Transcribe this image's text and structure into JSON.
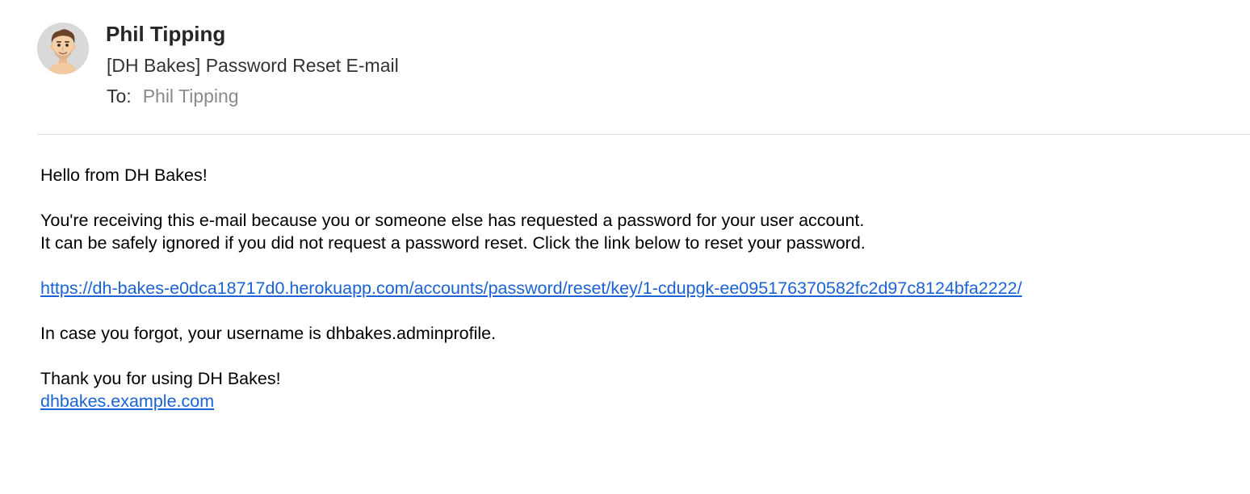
{
  "header": {
    "avatar_icon": "memoji-avatar-icon",
    "sender_name": "Phil Tipping",
    "subject": "[DH Bakes] Password Reset E-mail",
    "to_label": "To:",
    "to_value": "Phil Tipping"
  },
  "body": {
    "greeting": "Hello from DH Bakes!",
    "line1": "You're receiving this e-mail because you or someone else has requested a password for your user account.",
    "line2": "It can be safely ignored if you did not request a password reset. Click the link below to reset your password.",
    "reset_link": "https://dh-bakes-e0dca18717d0.herokuapp.com/accounts/password/reset/key/1-cdupgk-ee095176370582fc2d97c8124bfa2222/",
    "username_note": "In case you forgot, your username is dhbakes.adminprofile.",
    "thanks": "Thank you for using DH Bakes!",
    "site_link": "dhbakes.example.com"
  },
  "colors": {
    "link": "#1a62d8",
    "muted": "#8a8a8a",
    "divider": "#dedede"
  }
}
